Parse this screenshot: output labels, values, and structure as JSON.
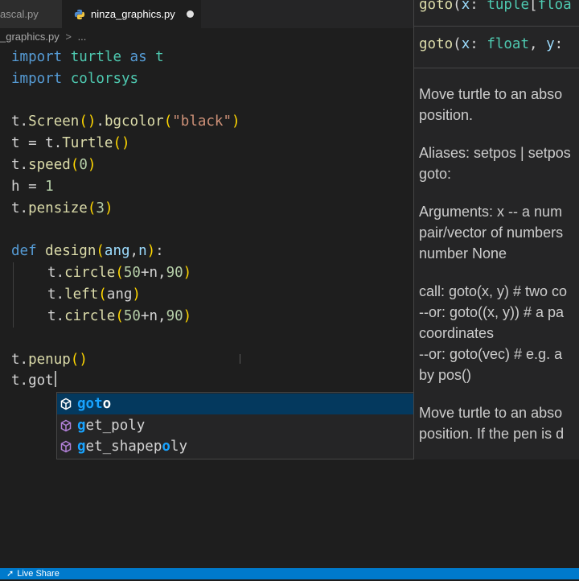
{
  "tabs": [
    {
      "label": "pascal.py",
      "visible_text": "ascal.py",
      "active": false
    },
    {
      "label": "ninza_graphics.py",
      "active": true,
      "modified": true
    }
  ],
  "breadcrumb": {
    "file": "_graphics.py",
    "sep": ">",
    "rest": "..."
  },
  "code": {
    "l1": {
      "kw": "import",
      "mod": "turtle",
      "kw2": "as",
      "alias": "t"
    },
    "l2": {
      "kw": "import",
      "mod": "colorsys"
    },
    "l4": {
      "obj": "t",
      "dot": ".",
      "fn": "Screen",
      "p1": "()",
      "dot2": ".",
      "fn2": "bgcolor",
      "po": "(",
      "str": "\"black\"",
      "pc": ")"
    },
    "l5": {
      "obj": "t",
      "eq": " = ",
      "obj2": "t",
      "dot": ".",
      "fn": "Turtle",
      "p": "()"
    },
    "l6": {
      "obj": "t",
      "dot": ".",
      "fn": "speed",
      "po": "(",
      "num": "0",
      "pc": ")"
    },
    "l7": {
      "var": "h",
      "eq": " = ",
      "num": "1"
    },
    "l8": {
      "obj": "t",
      "dot": ".",
      "fn": "pensize",
      "po": "(",
      "num": "3",
      "pc": ")"
    },
    "l10": {
      "kw": "def",
      "fn": "design",
      "po": "(",
      "a1": "ang",
      "comma": ",",
      "a2": "n",
      "pc": ")",
      "colon": ":"
    },
    "l11": {
      "obj": "t",
      "dot": ".",
      "fn": "circle",
      "po": "(",
      "n1": "50",
      "plus": "+",
      "v": "n",
      "comma": ",",
      "n2": "90",
      "pc": ")"
    },
    "l12": {
      "obj": "t",
      "dot": ".",
      "fn": "left",
      "po": "(",
      "v": "ang",
      "pc": ")"
    },
    "l13": {
      "obj": "t",
      "dot": ".",
      "fn": "circle",
      "po": "(",
      "n1": "50",
      "plus": "+",
      "v": "n",
      "comma": ",",
      "n2": "90",
      "pc": ")"
    },
    "l15": {
      "obj": "t",
      "dot": ".",
      "fn": "penup",
      "p": "()"
    },
    "l16": {
      "obj": "t",
      "dot": ".",
      "typed": "got"
    }
  },
  "suggestions": [
    {
      "match": "got",
      "rest": "o",
      "icon": "method-cube-icon",
      "selected": true
    },
    {
      "pre": "g",
      "match": "et_poly",
      "rest": "",
      "icon": "method-cube-icon",
      "selected": false
    },
    {
      "pre": "g",
      "m1": "et_sha",
      "mid": "pep",
      "m2": "o",
      "post": "ly",
      "icon": "method-cube-icon",
      "selected": false
    }
  ],
  "details": {
    "sig1": {
      "fn": "goto",
      "po": "(",
      "p": "x",
      "colon": ": ",
      "type": "tuple",
      "br": "[",
      "t2": "floa"
    },
    "sig2": {
      "fn": "goto",
      "po": "(",
      "p": "x",
      "colon": ": ",
      "type": "float",
      "comma": ", ",
      "p2": "y",
      "colon2": ": "
    },
    "doc": [
      [
        "Move turtle to an abso",
        "position."
      ],
      [
        "Aliases: setpos | setpos",
        "goto:"
      ],
      [
        "Arguments: x -- a num",
        "pair/vector of numbers",
        "number None"
      ],
      [
        "call: goto(x, y) # two co",
        "--or: goto((x, y)) # a pa",
        "coordinates",
        "--or: goto(vec) # e.g. a",
        "by pos()"
      ],
      [
        "Move turtle to an abso",
        "position. If the pen is d"
      ]
    ]
  },
  "status": {
    "live_share": "Live Share"
  },
  "colors": {
    "accent": "#007acc",
    "selection": "#04395e",
    "match_highlight": "#18a3ff"
  }
}
